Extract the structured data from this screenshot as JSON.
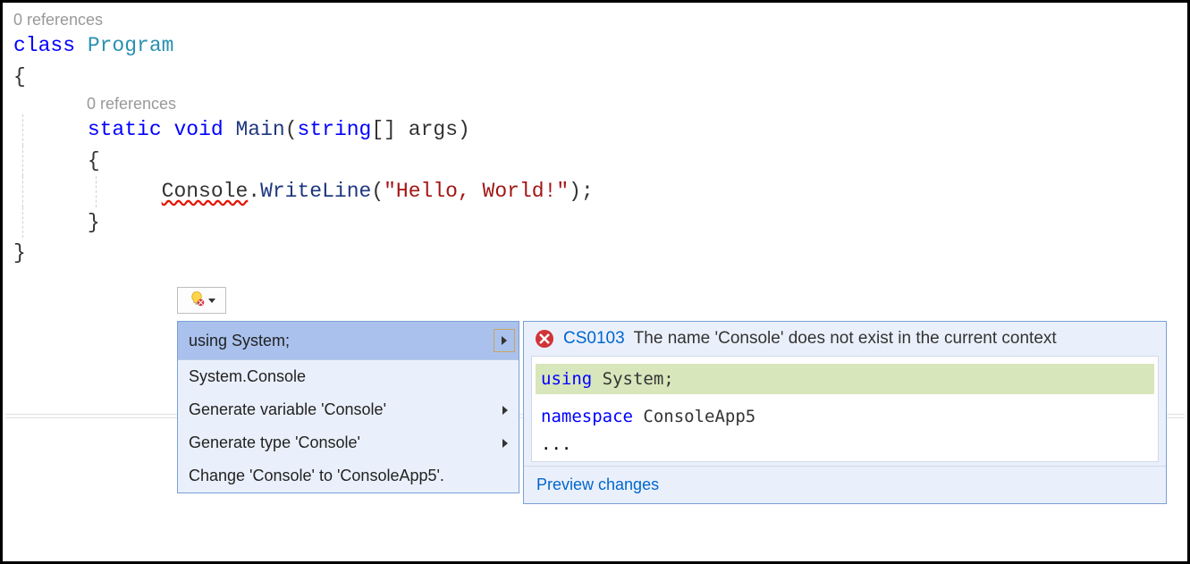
{
  "codelens": {
    "class_refs": "0 references",
    "main_refs": "0 references"
  },
  "code": {
    "class_kw": "class",
    "class_name": "Program",
    "open_brace": "{",
    "static_kw": "static",
    "void_kw": "void",
    "main_name": "Main",
    "string_kw": "string",
    "brackets": "[]",
    "args": "args",
    "open_paren": "(",
    "close_paren": ")",
    "open_brace2": "{",
    "console": "Console",
    "dot": ".",
    "writeline": "WriteLine",
    "string_lit": "\"Hello, World!\"",
    "semicolon": ";",
    "close_brace2": "}",
    "close_brace": "}"
  },
  "quickfix": {
    "items": [
      {
        "label": "using System;",
        "has_submenu": true,
        "selected": true
      },
      {
        "label": "System.Console",
        "has_submenu": false
      },
      {
        "label": "Generate variable 'Console'",
        "has_submenu": true
      },
      {
        "label": "Generate type 'Console'",
        "has_submenu": true
      },
      {
        "label": "Change 'Console' to 'ConsoleApp5'.",
        "has_submenu": false
      }
    ]
  },
  "preview": {
    "error_code": "CS0103",
    "error_msg": "The name 'Console' does not exist in the current context",
    "added_using_kw": "using",
    "added_using_target": "System",
    "added_semicolon": ";",
    "ns_kw": "namespace",
    "ns_name": "ConsoleApp5",
    "ellipsis": "...",
    "footer_link": "Preview changes"
  }
}
